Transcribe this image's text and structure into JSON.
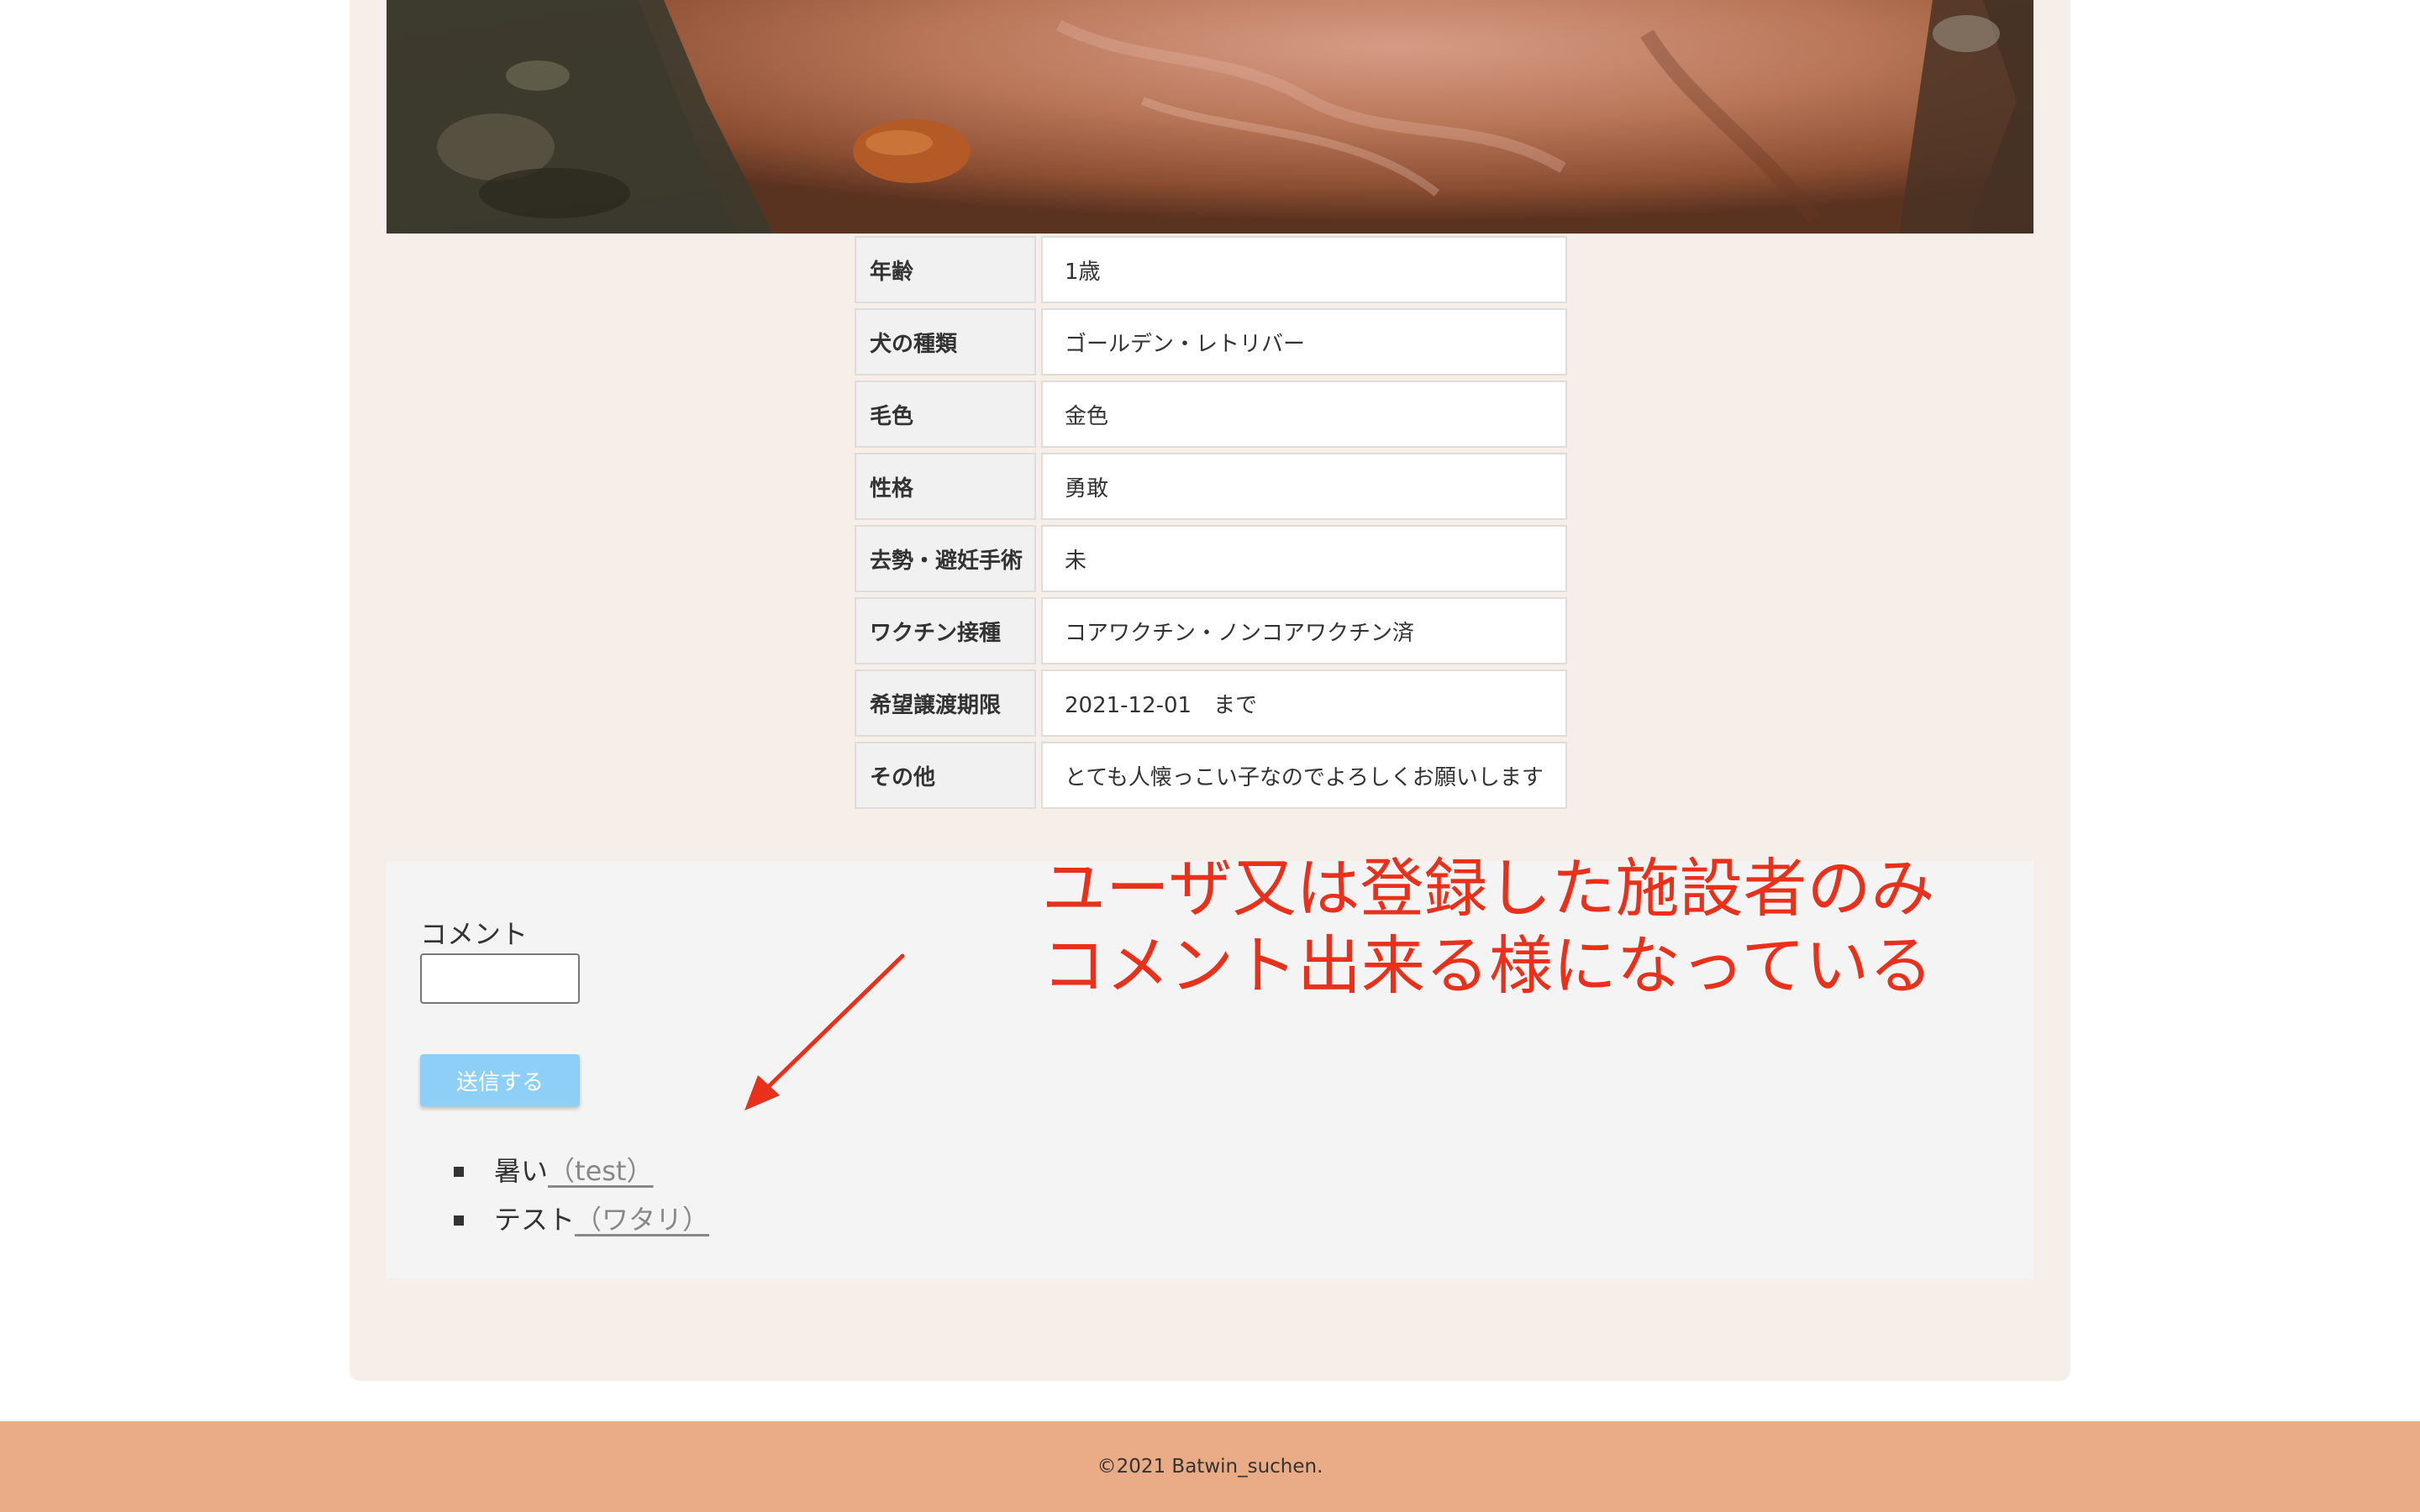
{
  "profile": {
    "rows": [
      {
        "label": "年齢",
        "value": "1歳"
      },
      {
        "label": "犬の種類",
        "value": "ゴールデン・レトリバー"
      },
      {
        "label": "毛色",
        "value": "金色"
      },
      {
        "label": "性格",
        "value": "勇敢"
      },
      {
        "label": "去勢・避妊手術",
        "value": "未"
      },
      {
        "label": "ワクチン接種",
        "value": "コアワクチン・ノンコアワクチン済"
      },
      {
        "label": "希望譲渡期限",
        "value": "2021-12-01　まで"
      },
      {
        "label": "その他",
        "value": "とても人懐っこい子なのでよろしくお願いします"
      }
    ]
  },
  "comments": {
    "label": "コメント",
    "input_value": "",
    "submit_label": "送信する",
    "items": [
      {
        "text": "暑い",
        "author": "（test）"
      },
      {
        "text": "テスト",
        "author": "（ワタリ）"
      }
    ]
  },
  "annotation": {
    "line1": "ユーザ又は登録した施設者のみ",
    "line2": "コメント出来る様になっている",
    "color": "#e8301b"
  },
  "footer": {
    "copyright": "©2021 Batwin_suchen."
  },
  "colors": {
    "card_background": "#f6efe9",
    "footer_background": "#e9ac86",
    "submit_button": "#8ecff7",
    "comment_panel": "#f4f4f4"
  }
}
